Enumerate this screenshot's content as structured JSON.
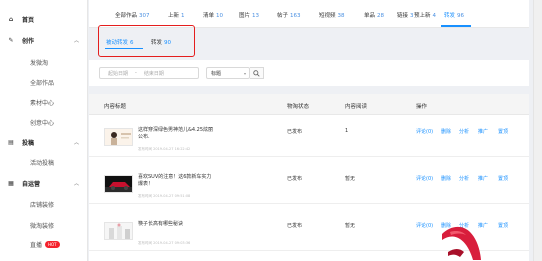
{
  "sidebar": {
    "groups": [
      {
        "label": "首页",
        "icon": "home-icon"
      },
      {
        "label": "创作",
        "icon": "pen-icon",
        "items": [
          "发微淘",
          "全部作品",
          "素材中心",
          "创意中心"
        ]
      },
      {
        "label": "投稿",
        "icon": "document-icon",
        "items": [
          "活动投稿"
        ]
      },
      {
        "label": "自运营",
        "icon": "grid-icon",
        "items": [
          "店铺装修",
          "微淘装修",
          "直播"
        ]
      }
    ],
    "badge": "HOT"
  },
  "tabs": [
    {
      "label": "全部作品",
      "count": "307"
    },
    {
      "label": "上新",
      "count": "1"
    },
    {
      "label": "清单",
      "count": "10"
    },
    {
      "label": "图片",
      "count": "13"
    },
    {
      "label": "帖子",
      "count": "163"
    },
    {
      "label": "短视频",
      "count": "38"
    },
    {
      "label": "单品",
      "count": "28"
    },
    {
      "label": "链接",
      "count": "3"
    },
    {
      "label": "预上新",
      "count": "4"
    },
    {
      "label": "转发",
      "count": "96"
    }
  ],
  "subtabs": [
    {
      "label": "被动转发",
      "count": "6"
    },
    {
      "label": "转发",
      "count": "90"
    }
  ],
  "filter": {
    "start_placeholder": "起始日期",
    "sep": "-",
    "end_placeholder": "结束日期",
    "select_value": "标题"
  },
  "table": {
    "headers": [
      "内容标题",
      "物淘状态",
      "内容阅读",
      "操作"
    ],
    "rows": [
      {
        "title": "这样穿深绿色男神范儿&4.25炫丽公布.",
        "meta": "发布时间 2019-04-27 16:22:42",
        "status": "已发布",
        "reads": "1"
      },
      {
        "title": "喜欢SUV的注意！这6款新车实力爆表！",
        "meta": "发布时间 2019-04-27 09:51:08",
        "status": "已发布",
        "reads": "暂无"
      },
      {
        "title": "筷子长高有哪些秘诀",
        "meta": "发布时间 2019-04-27 09:03:36",
        "status": "已发布",
        "reads": "暂无"
      }
    ],
    "actions": [
      "评论(0)",
      "删除",
      "分析",
      "推广",
      "置顶"
    ]
  },
  "colors": {
    "accent": "#1890ff",
    "highlight": "#e41e1e",
    "ribbon": "#d81e3c"
  }
}
